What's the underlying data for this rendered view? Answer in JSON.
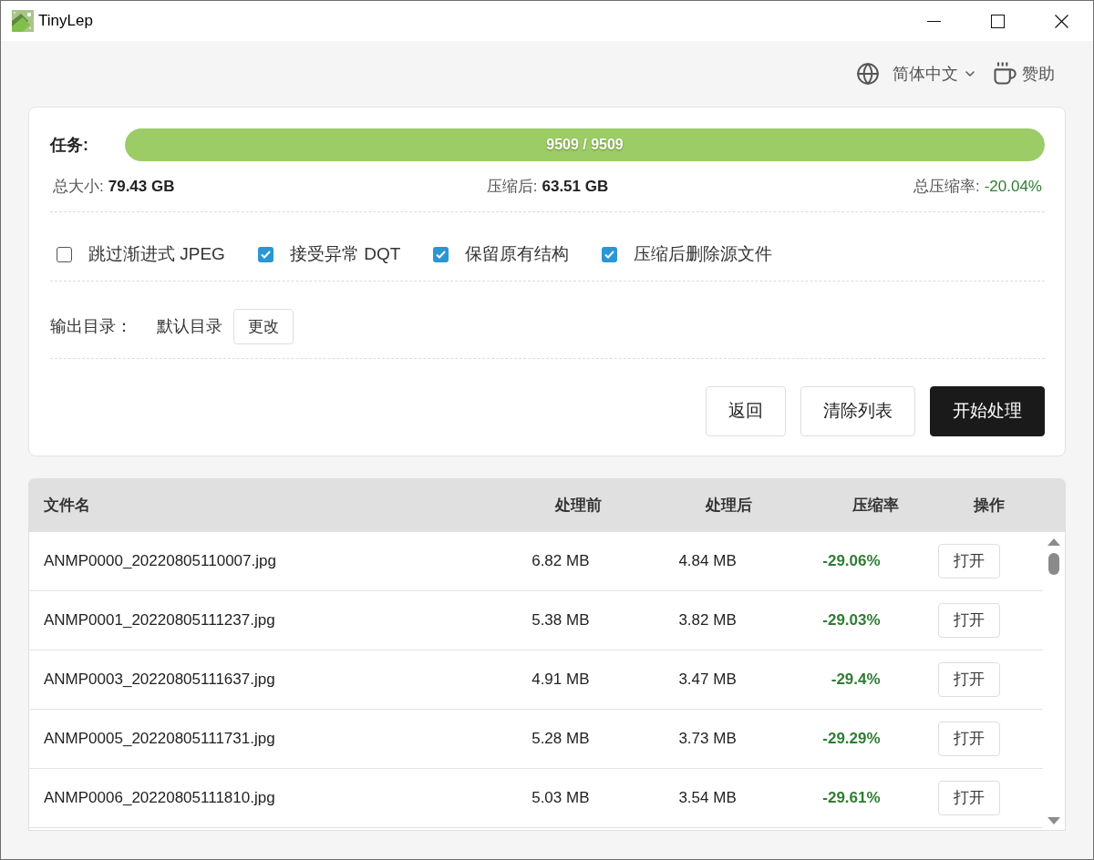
{
  "window": {
    "title": "TinyLep"
  },
  "header": {
    "language": "简体中文",
    "sponsor": "赞助"
  },
  "task": {
    "label": "任务:",
    "progress": {
      "level": 1,
      "text": "9509 / 9509"
    }
  },
  "stats": [
    {
      "label": "总大小:",
      "value": "79.43 GB",
      "kind": "plain"
    },
    {
      "label": "压缩后:",
      "value": "63.51 GB",
      "kind": "plain"
    },
    {
      "label": "总压缩率:",
      "value": "-20.04%",
      "kind": "rate"
    }
  ],
  "options": [
    {
      "label": "跳过渐进式 JPEG",
      "checked": false
    },
    {
      "label": "接受异常 DQT",
      "checked": true
    },
    {
      "label": "保留原有结构",
      "checked": true
    },
    {
      "label": "压缩后删除源文件",
      "checked": true
    }
  ],
  "output": {
    "label": "输出目录：",
    "value": "默认目录",
    "button": "更改"
  },
  "actions": [
    {
      "label": "返回",
      "kind": "secondary"
    },
    {
      "label": "清除列表",
      "kind": "secondary"
    },
    {
      "label": "开始处理",
      "kind": "primary"
    }
  ],
  "table": {
    "columns": [
      "文件名",
      "处理前",
      "处理后",
      "压缩率",
      "操作"
    ],
    "rows": [
      {
        "file": "ANMP0000_20220805110007.jpg",
        "before": "6.82 MB",
        "after": "4.84 MB",
        "rate": "-29.06%",
        "action": "打开"
      },
      {
        "file": "ANMP0001_20220805111237.jpg",
        "before": "5.38 MB",
        "after": "3.82 MB",
        "rate": "-29.03%",
        "action": "打开"
      },
      {
        "file": "ANMP0003_20220805111637.jpg",
        "before": "4.91 MB",
        "after": "3.47 MB",
        "rate": "-29.4%",
        "action": "打开"
      },
      {
        "file": "ANMP0005_20220805111731.jpg",
        "before": "5.28 MB",
        "after": "3.73 MB",
        "rate": "-29.29%",
        "action": "打开"
      },
      {
        "file": "ANMP0006_20220805111810.jpg",
        "before": "5.03 MB",
        "after": "3.54 MB",
        "rate": "-29.61%",
        "action": "打开"
      }
    ]
  }
}
